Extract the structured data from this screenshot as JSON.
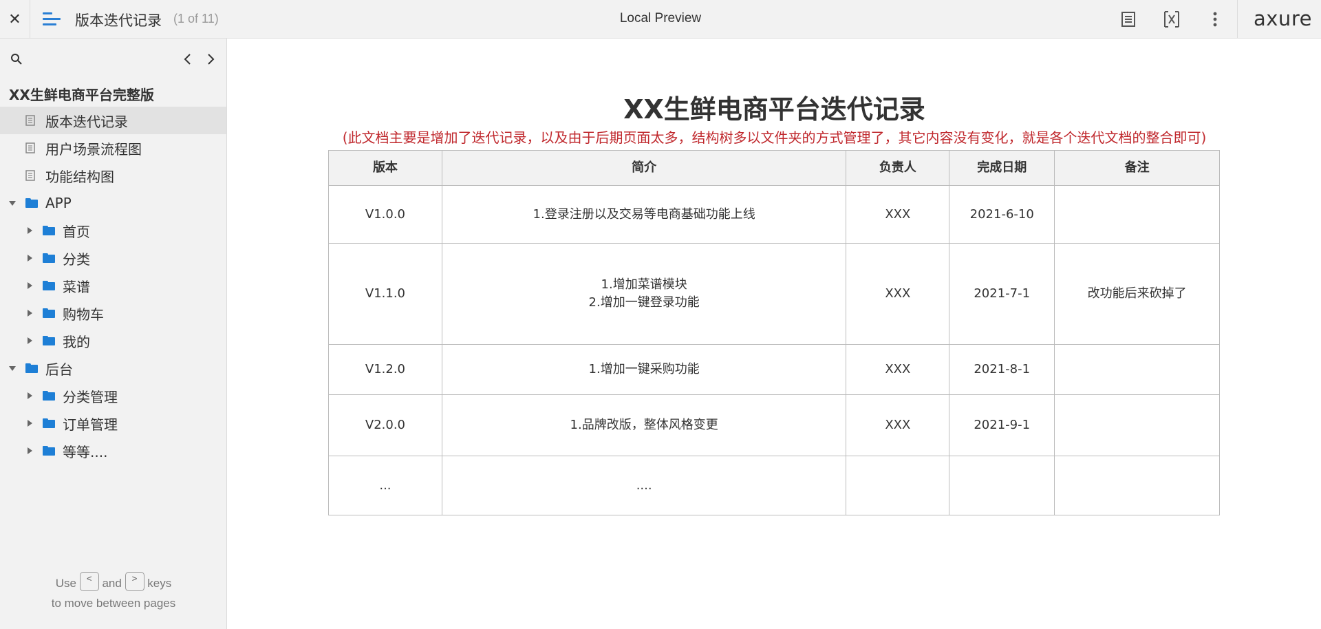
{
  "topbar": {
    "close_glyph": "✕",
    "page_title": "版本迭代记录",
    "page_count": "(1 of 11)",
    "center_label": "Local Preview",
    "logo": "axure",
    "icons": [
      "close-icon",
      "menu-icon",
      "notes-icon",
      "variables-icon",
      "more-icon"
    ]
  },
  "sidebar": {
    "root_label": "XX生鲜电商平台完整版",
    "items": [
      {
        "label": "版本迭代记录",
        "type": "page",
        "selected": true
      },
      {
        "label": "用户场景流程图",
        "type": "page"
      },
      {
        "label": "功能结构图",
        "type": "page"
      },
      {
        "label": "APP",
        "type": "folder",
        "expanded": true
      },
      {
        "label": "首页",
        "type": "folder"
      },
      {
        "label": "分类",
        "type": "folder"
      },
      {
        "label": "菜谱",
        "type": "folder"
      },
      {
        "label": "购物车",
        "type": "folder"
      },
      {
        "label": "我的",
        "type": "folder"
      },
      {
        "label": "后台",
        "type": "folder",
        "expanded": true
      },
      {
        "label": "分类管理",
        "type": "folder"
      },
      {
        "label": "订单管理",
        "type": "folder"
      },
      {
        "label": "等等....",
        "type": "folder"
      }
    ],
    "hint": {
      "use": "Use",
      "key_prev": "<",
      "and": "and",
      "key_next": ">",
      "keys": "keys",
      "line2": "to move between pages"
    }
  },
  "document": {
    "title": "XX生鲜电商平台迭代记录",
    "subtitle": "(此文档主要是增加了迭代记录，以及由于后期页面太多，结构树多以文件夹的方式管理了，其它内容没有变化，就是各个迭代文档的整合即可)",
    "table": {
      "headers": [
        "版本",
        "简介",
        "负责人",
        "完成日期",
        "备注"
      ],
      "rows": [
        {
          "version": "V1.0.0",
          "summary": "1.登录注册以及交易等电商基础功能上线",
          "owner": "XXX",
          "date": "2021-6-10",
          "note": ""
        },
        {
          "version": "V1.1.0",
          "summary": "1.增加菜谱模块",
          "summary2": "2.增加一键登录功能",
          "owner": "XXX",
          "date": "2021-7-1",
          "note": "改功能后来砍掉了"
        },
        {
          "version": "V1.2.0",
          "summary": "1.增加一键采购功能",
          "owner": "XXX",
          "date": "2021-8-1",
          "note": ""
        },
        {
          "version": "V2.0.0",
          "summary": "1.品牌改版，整体风格变更",
          "owner": "XXX",
          "date": "2021-9-1",
          "note": ""
        },
        {
          "version": "...",
          "summary": "....",
          "owner": "",
          "date": "",
          "note": ""
        }
      ]
    }
  }
}
